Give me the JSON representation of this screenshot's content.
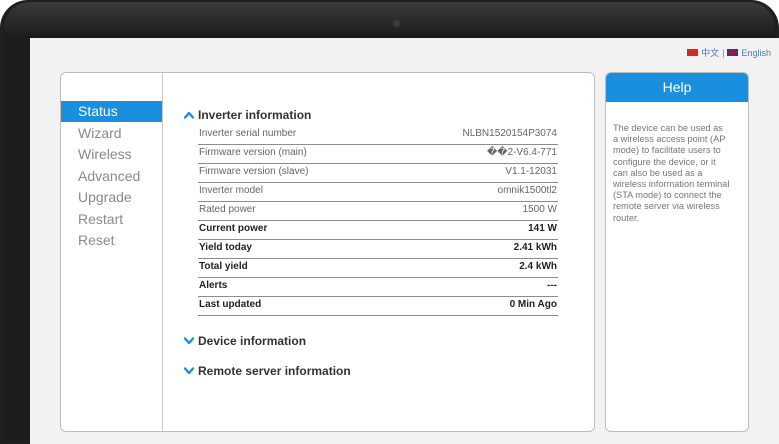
{
  "language": {
    "chinese": "中文",
    "separator": "|",
    "english": "English"
  },
  "sidebar": {
    "items": [
      {
        "label": "Status",
        "active": true
      },
      {
        "label": "Wizard"
      },
      {
        "label": "Wireless"
      },
      {
        "label": "Advanced"
      },
      {
        "label": "Upgrade"
      },
      {
        "label": "Restart"
      },
      {
        "label": "Reset"
      }
    ]
  },
  "sections": {
    "inverter": {
      "title": "Inverter information",
      "expanded": true,
      "icon": "chevron-up-icon"
    },
    "device": {
      "title": "Device information",
      "expanded": false,
      "icon": "chevron-down-icon"
    },
    "remote": {
      "title": "Remote server information",
      "expanded": false,
      "icon": "chevron-down-icon"
    }
  },
  "inverter_rows": [
    {
      "label": "Inverter serial number",
      "value": "NLBN1520154P3074"
    },
    {
      "label": "Firmware version (main)",
      "value": "��2-V6.4-771"
    },
    {
      "label": "Firmware version (slave)",
      "value": "V1.1-12031"
    },
    {
      "label": "Inverter model",
      "value": "omnik1500tl2"
    },
    {
      "label": "Rated power",
      "value": "1500 W"
    },
    {
      "label": "Current power",
      "value": "141 W"
    },
    {
      "label": "Yield today",
      "value": "2.41 kWh"
    },
    {
      "label": "Total yield",
      "value": "2.4 kWh"
    },
    {
      "label": "Alerts",
      "value": "---"
    },
    {
      "label": "Last updated",
      "value": "0 Min Ago"
    }
  ],
  "help": {
    "title": "Help",
    "lines": [
      "The device can be used as",
      "a wireless access point (AP",
      "mode) to facilitate users to",
      "configure the device, or it",
      "can also be used as a",
      "wireless information terminal",
      "(STA mode) to connect the",
      "remote server via wireless",
      "router."
    ]
  },
  "colors": {
    "accent": "#1a8fe0",
    "bezel": "#1f1f1f"
  }
}
